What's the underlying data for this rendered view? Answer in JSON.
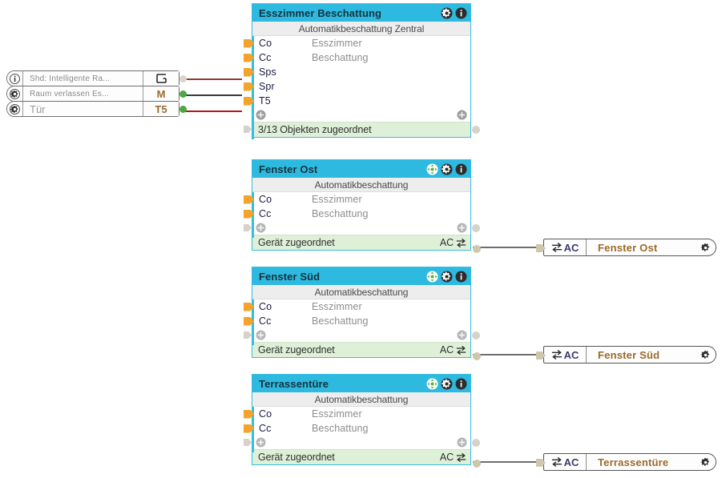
{
  "canvas": {
    "background": "#ffffff",
    "accent_header": "#2ebae0",
    "footer_green": "#dff0d8",
    "subtitle_grey": "#ededed",
    "input_port_orange": "#f5a32a",
    "device_text_brown": "#9a6a2a"
  },
  "sources": [
    {
      "icon": "info-icon",
      "label": "Shd: Intelligente Ra...",
      "tag": "G",
      "tag_icon": "logic-gate-icon",
      "port_color": "grey",
      "wire_color": "#8f3a32"
    },
    {
      "icon": "gear-icon",
      "label": "Raum verlassen Es...",
      "tag": "M",
      "tag_icon": "",
      "port_color": "green",
      "wire_color": "#3a3a3a"
    },
    {
      "icon": "gear-icon",
      "label": "Tür",
      "label_size": "big",
      "tag": "T5",
      "tag_icon": "",
      "port_color": "green",
      "wire_color": "#b11a1a"
    }
  ],
  "nodes": [
    {
      "title": "Esszimmer Beschattung",
      "subtitle": "Automatikbeschattung Zentral",
      "icons": [
        "gear-icon",
        "info-icon"
      ],
      "has_move_icon": false,
      "rows": [
        {
          "key": "Co",
          "value": "Esszimmer",
          "connected": false
        },
        {
          "key": "Cc",
          "value": "Beschattung",
          "connected": false
        },
        {
          "key": "Sps",
          "value": "",
          "connected": true
        },
        {
          "key": "Spr",
          "value": "",
          "connected": true
        },
        {
          "key": "T5",
          "value": "",
          "connected": true
        }
      ],
      "footer_text": "3/13 Objekten zugeordnet",
      "footer_right": "",
      "footer_has_swap": false
    },
    {
      "title": "Fenster Ost",
      "subtitle": "Automatikbeschattung",
      "icons": [
        "move-icon",
        "gear-icon",
        "info-icon"
      ],
      "has_move_icon": true,
      "rows": [
        {
          "key": "Co",
          "value": "Esszimmer",
          "connected": false
        },
        {
          "key": "Cc",
          "value": "Beschattung",
          "connected": false
        }
      ],
      "footer_text": "Gerät zugeordnet",
      "footer_right": "AC",
      "footer_has_swap": true
    },
    {
      "title": "Fenster Süd",
      "subtitle": "Automatikbeschattung",
      "icons": [
        "move-icon",
        "gear-icon",
        "info-icon"
      ],
      "has_move_icon": true,
      "rows": [
        {
          "key": "Co",
          "value": "Esszimmer",
          "connected": false
        },
        {
          "key": "Cc",
          "value": "Beschattung",
          "connected": false
        }
      ],
      "footer_text": "Gerät zugeordnet",
      "footer_right": "AC",
      "footer_has_swap": true
    },
    {
      "title": "Terrassentüre",
      "subtitle": "Automatikbeschattung",
      "icons": [
        "move-icon",
        "gear-icon",
        "info-icon"
      ],
      "has_move_icon": true,
      "rows": [
        {
          "key": "Co",
          "value": "Esszimmer",
          "connected": false
        },
        {
          "key": "Cc",
          "value": "Beschattung",
          "connected": false
        }
      ],
      "footer_text": "Gerät zugeordnet",
      "footer_right": "AC",
      "footer_has_swap": true
    }
  ],
  "devices": [
    {
      "ac_label": "AC",
      "name": "Fenster Ost",
      "gear": "gear-icon",
      "swap": "swap-icon"
    },
    {
      "ac_label": "AC",
      "name": "Fenster Süd",
      "gear": "gear-icon",
      "swap": "swap-icon"
    },
    {
      "ac_label": "AC",
      "name": "Terrassentüre",
      "gear": "gear-icon",
      "swap": "swap-icon"
    }
  ]
}
